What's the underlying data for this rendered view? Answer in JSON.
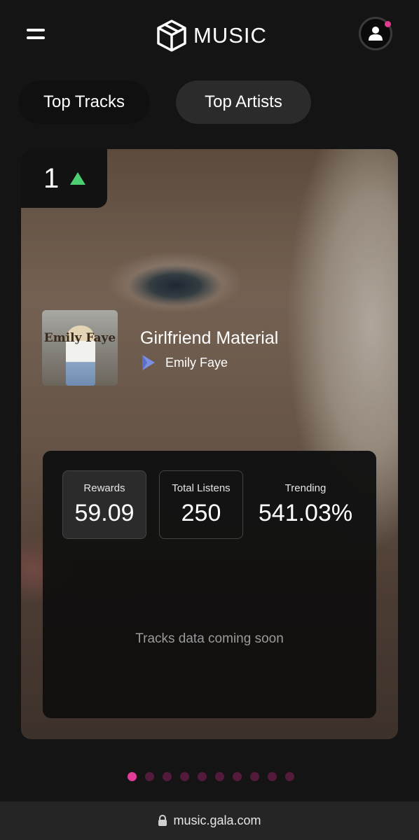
{
  "header": {
    "brand": "MUSIC",
    "icons": {
      "menu": "hamburger-menu-icon",
      "logo": "gala-cube-logo",
      "account": "user-icon"
    },
    "notification_color": "#e5398f"
  },
  "tabs": [
    {
      "label": "Top Tracks",
      "selected": false
    },
    {
      "label": "Top Artists",
      "selected": true
    }
  ],
  "card": {
    "rank": "1",
    "rank_trend": "up",
    "rank_trend_color": "#4ccf72",
    "cover_text": "Emily Faye",
    "track_title": "Girlfriend Material",
    "artist_icon": "play-badge-icon",
    "artist_name": "Emily Faye",
    "stats": {
      "rewards_label": "Rewards",
      "rewards_value": "59.09",
      "listens_label": "Total Listens",
      "listens_value": "250",
      "trending_label": "Trending",
      "trending_value": "541.03%"
    },
    "placeholder": "Tracks data coming soon"
  },
  "pagination": {
    "count": 10,
    "active_index": 0,
    "active_color": "#e23b98",
    "inactive_color": "#541a3b"
  },
  "address_bar": {
    "url": "music.gala.com",
    "icon": "lock-icon"
  }
}
